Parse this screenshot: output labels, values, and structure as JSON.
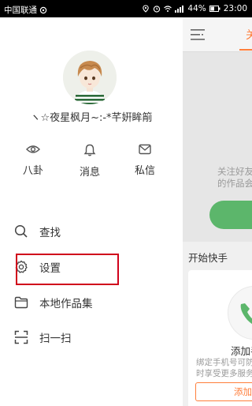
{
  "status_bar": {
    "carrier": "中国联通",
    "battery": "44%",
    "time": "23:00"
  },
  "profile": {
    "username": "ヽ☆夜星枫月~:-*芊姸眸箾"
  },
  "stats": [
    {
      "icon": "eye-icon",
      "label": "八卦"
    },
    {
      "icon": "bell-icon",
      "label": "消息"
    },
    {
      "icon": "mail-icon",
      "label": "私信"
    }
  ],
  "menu": [
    {
      "icon": "search-icon",
      "label": "查找"
    },
    {
      "icon": "gear-icon",
      "label": "设置"
    },
    {
      "icon": "folder-icon",
      "label": "本地作品集"
    },
    {
      "icon": "scan-icon",
      "label": "扫一扫"
    }
  ],
  "background": {
    "tab_label": "关",
    "follow_hint_line1": "关注好友",
    "follow_hint_line2": "的作品会",
    "section_title": "开始快手",
    "card_title": "添加手",
    "card_desc_line1": "绑定手机号可防",
    "card_desc_line2": "时享受更多服务",
    "card_button": "添加手"
  },
  "colors": {
    "accent": "#ff7e3b",
    "highlight_box": "#d0021b",
    "green": "#5cb66b"
  }
}
